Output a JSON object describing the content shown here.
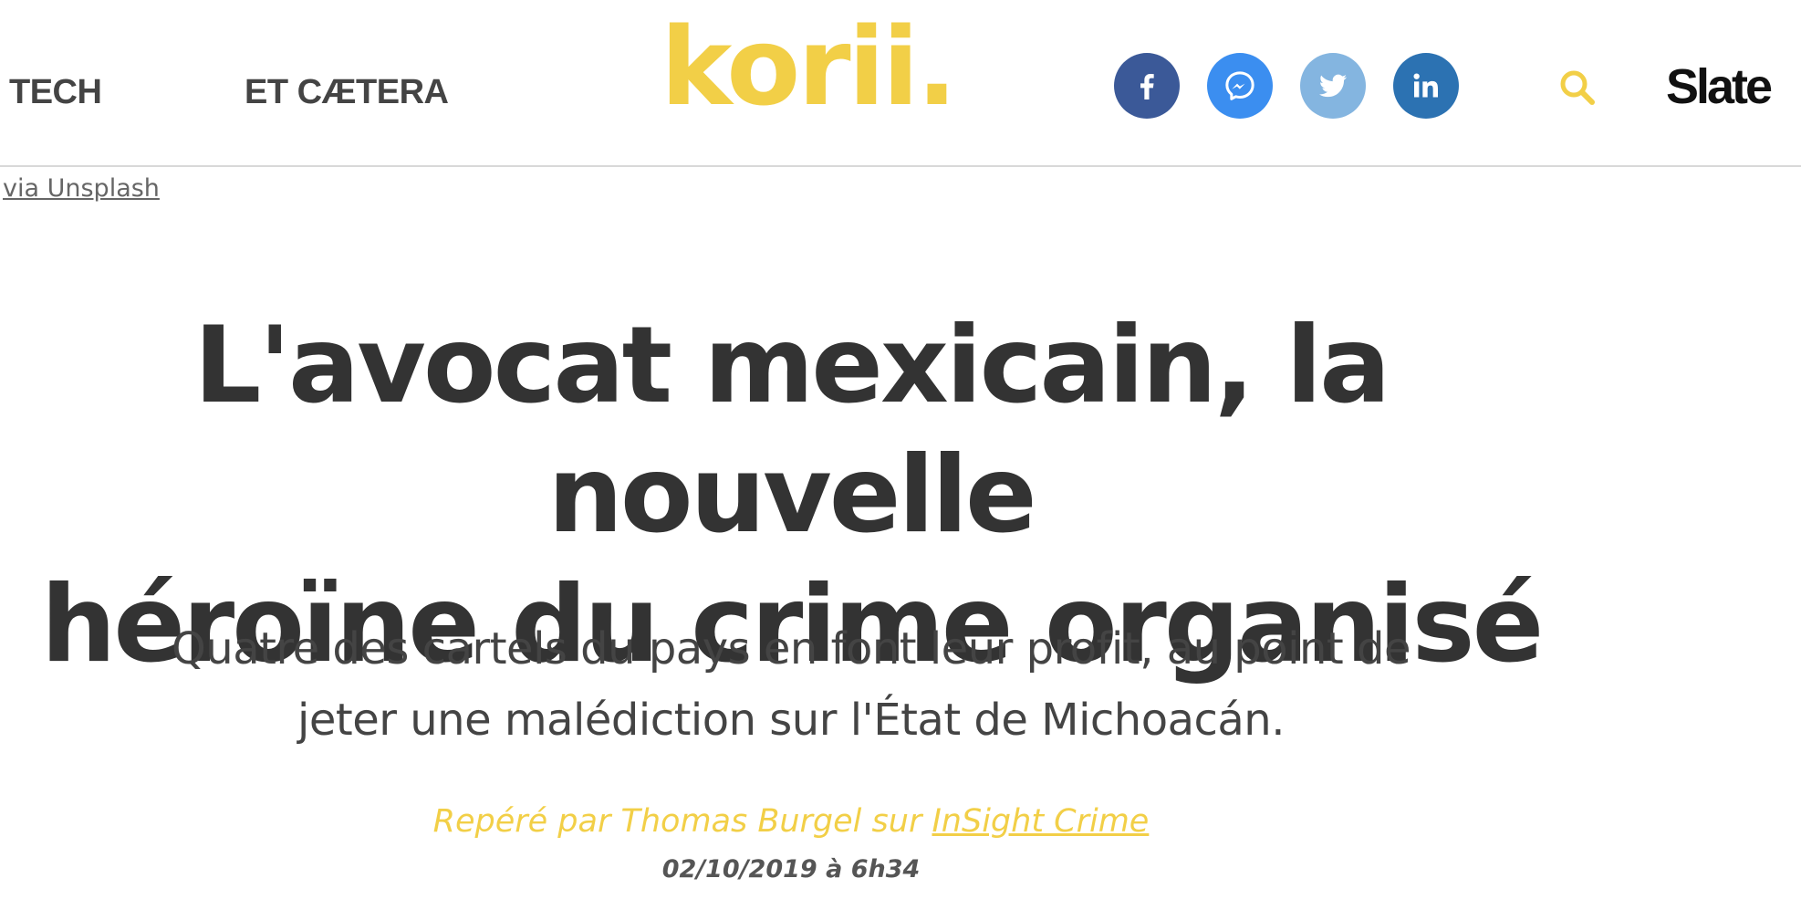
{
  "nav": {
    "items": [
      {
        "label": "TECH"
      },
      {
        "label": "ET CÆTERA"
      }
    ]
  },
  "logo": {
    "text": "korii",
    "dot": "."
  },
  "social": {
    "facebook": {
      "icon": "facebook-icon",
      "color": "#3b5998"
    },
    "messenger": {
      "icon": "messenger-icon",
      "color": "#3b8ef0"
    },
    "twitter": {
      "icon": "twitter-icon",
      "color": "#84b5e0"
    },
    "linkedin": {
      "icon": "linkedin-icon",
      "color": "#2c72b2"
    }
  },
  "search": {
    "icon": "search-icon"
  },
  "partner": {
    "label": "Slate"
  },
  "article": {
    "image_credit": "via Unsplash",
    "title_line1": "L'avocat mexicain, la nouvelle",
    "title_line2": "héroïne du crime organisé",
    "subtitle_line1": "Quatre des cartels du pays en font leur profit, au point de",
    "subtitle_line2": "jeter une malédiction sur l'État de Michoacán.",
    "spotted_prefix": "Repéré par Thomas Burgel sur ",
    "spotted_source": "InSight Crime",
    "date": "02/10/2019 à 6h34"
  },
  "colors": {
    "brand_yellow": "#f2cf47",
    "text_dark": "#333333",
    "divider": "#d8d8d8"
  }
}
